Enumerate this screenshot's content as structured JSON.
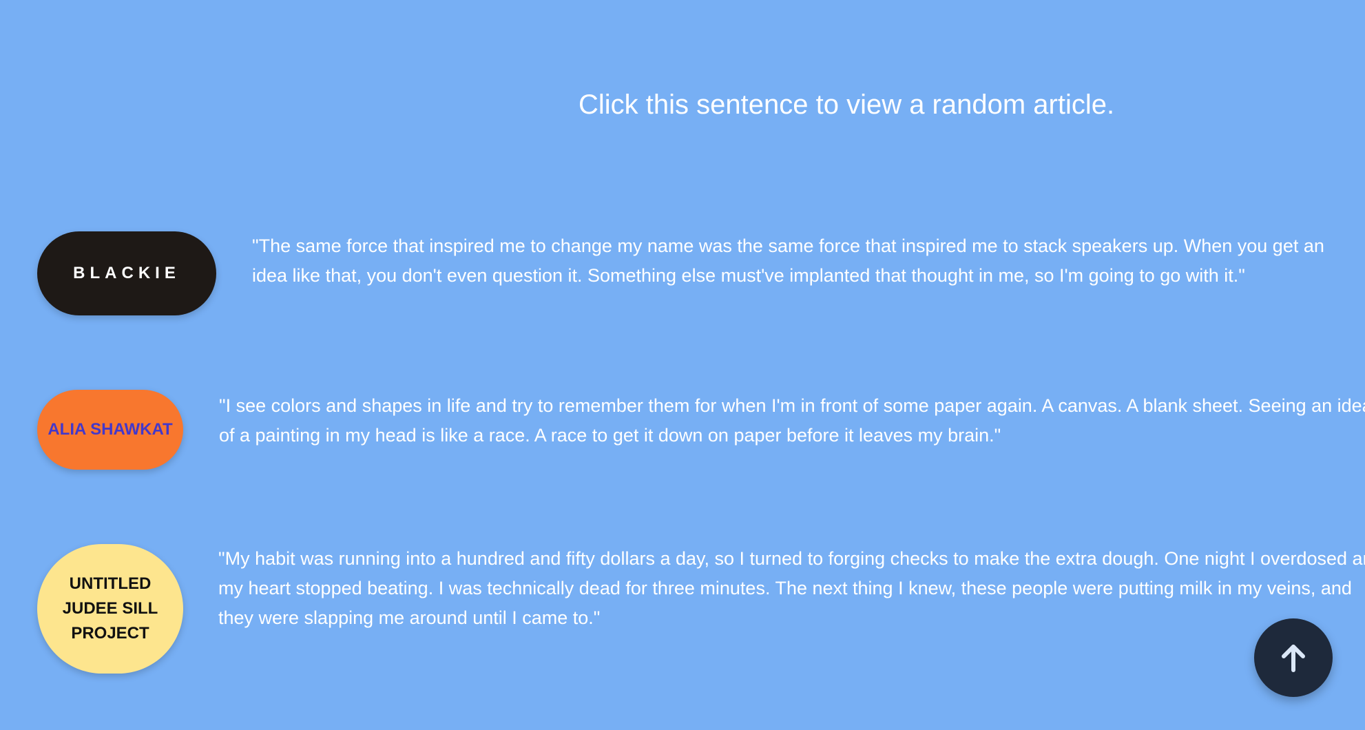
{
  "header": {
    "random_article_link": "Click this sentence to view a random article."
  },
  "entries": [
    {
      "artist": "BLACKIE",
      "quote": "\"The same force that inspired me to change my name was the same force that inspired me to stack speakers up. When you get an idea like that, you don't even question it. Something else must've implanted that thought in me, so I'm going to go with it.\"",
      "pill_color": "#1e1916",
      "label_color": "#ffffff"
    },
    {
      "artist": "ALIA SHAWKAT",
      "quote": "\"I see colors and shapes in life and try to remember them for when I'm in front of some paper again. A canvas. A blank sheet. Seeing an idea of a painting in my head is like a race. A race to get it down on paper before it leaves my brain.\"",
      "pill_color": "#f8772e",
      "label_color": "#4338ca"
    },
    {
      "artist": "UNTITLED JUDEE SILL PROJECT",
      "quote": "\"My habit was running into a hundred and fifty dollars a day, so I turned to forging checks to make the extra dough. One night I overdosed and my heart stopped beating. I was technically dead for three minutes. The next thing I knew, these people were putting milk in my veins, and they were slapping me around until I came to.\"",
      "pill_color": "#fde58e",
      "label_color": "#111111"
    }
  ],
  "scroll_top_button": {
    "icon": "arrow-up-icon"
  },
  "colors": {
    "background": "#77aff4",
    "button": "#1e293b"
  }
}
